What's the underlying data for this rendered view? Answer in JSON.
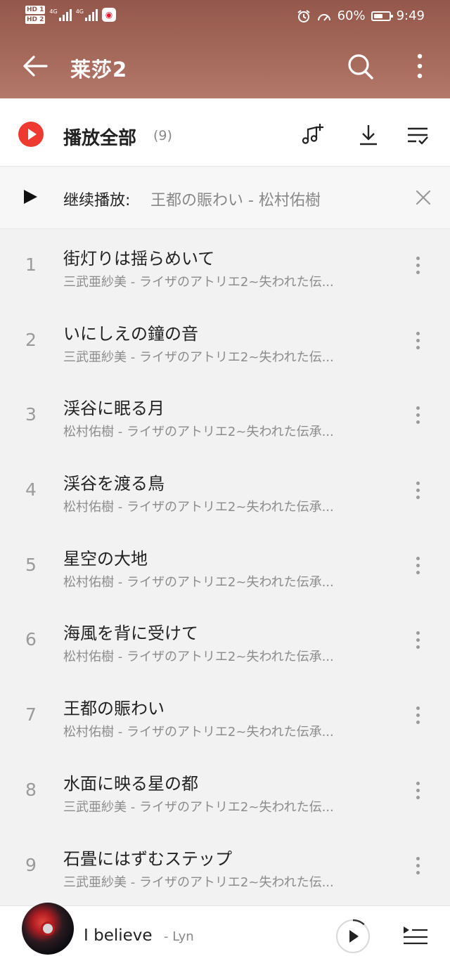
{
  "status_bar": {
    "left_badges": [
      "HD 1",
      "HD 2"
    ],
    "network_1": "4G",
    "network_2": "4G",
    "app_badge_icon": "weibo-icon",
    "battery_percent": "60%",
    "battery_level": 0.6,
    "time": "9:49"
  },
  "header": {
    "title": "莱莎2",
    "back_icon": "arrow-left-icon",
    "search_icon": "search-icon",
    "more_icon": "more-vertical-icon"
  },
  "play_all": {
    "label": "播放全部",
    "count": "(9)",
    "icons": [
      "add-music-icon",
      "download-icon",
      "manage-list-icon"
    ],
    "accent": "#ee3a31"
  },
  "resume": {
    "label": "继续播放",
    "separator": ":",
    "track": "王都の賑わい - 松村佑樹"
  },
  "songs": [
    {
      "num": "1",
      "title": "街灯りは揺らめいて",
      "subtitle": "三武亜紗美 - ライザのアトリエ2~失われた伝..."
    },
    {
      "num": "2",
      "title": "いにしえの鐘の音",
      "subtitle": "三武亜紗美 - ライザのアトリエ2~失われた伝..."
    },
    {
      "num": "3",
      "title": "渓谷に眠る月",
      "subtitle": "松村佑樹 - ライザのアトリエ2~失われた伝承..."
    },
    {
      "num": "4",
      "title": "渓谷を渡る鳥",
      "subtitle": "松村佑樹 - ライザのアトリエ2~失われた伝承..."
    },
    {
      "num": "5",
      "title": "星空の大地",
      "subtitle": "松村佑樹 - ライザのアトリエ2~失われた伝承..."
    },
    {
      "num": "6",
      "title": "海風を背に受けて",
      "subtitle": "松村佑樹 - ライザのアトリエ2~失われた伝承..."
    },
    {
      "num": "7",
      "title": "王都の賑わい",
      "subtitle": "松村佑樹 - ライザのアトリエ2~失われた伝承..."
    },
    {
      "num": "8",
      "title": "水面に映る星の都",
      "subtitle": "三武亜紗美 - ライザのアトリエ2~失われた伝..."
    },
    {
      "num": "9",
      "title": "石畳にはずむステップ",
      "subtitle": "三武亜紗美 - ライザのアトリエ2~失われた伝..."
    }
  ],
  "now_playing": {
    "title": "I believe",
    "separator": "-",
    "artist": "Lyn",
    "progress": 0.12,
    "play_icon": "play-circle-icon",
    "queue_icon": "playlist-queue-icon"
  }
}
